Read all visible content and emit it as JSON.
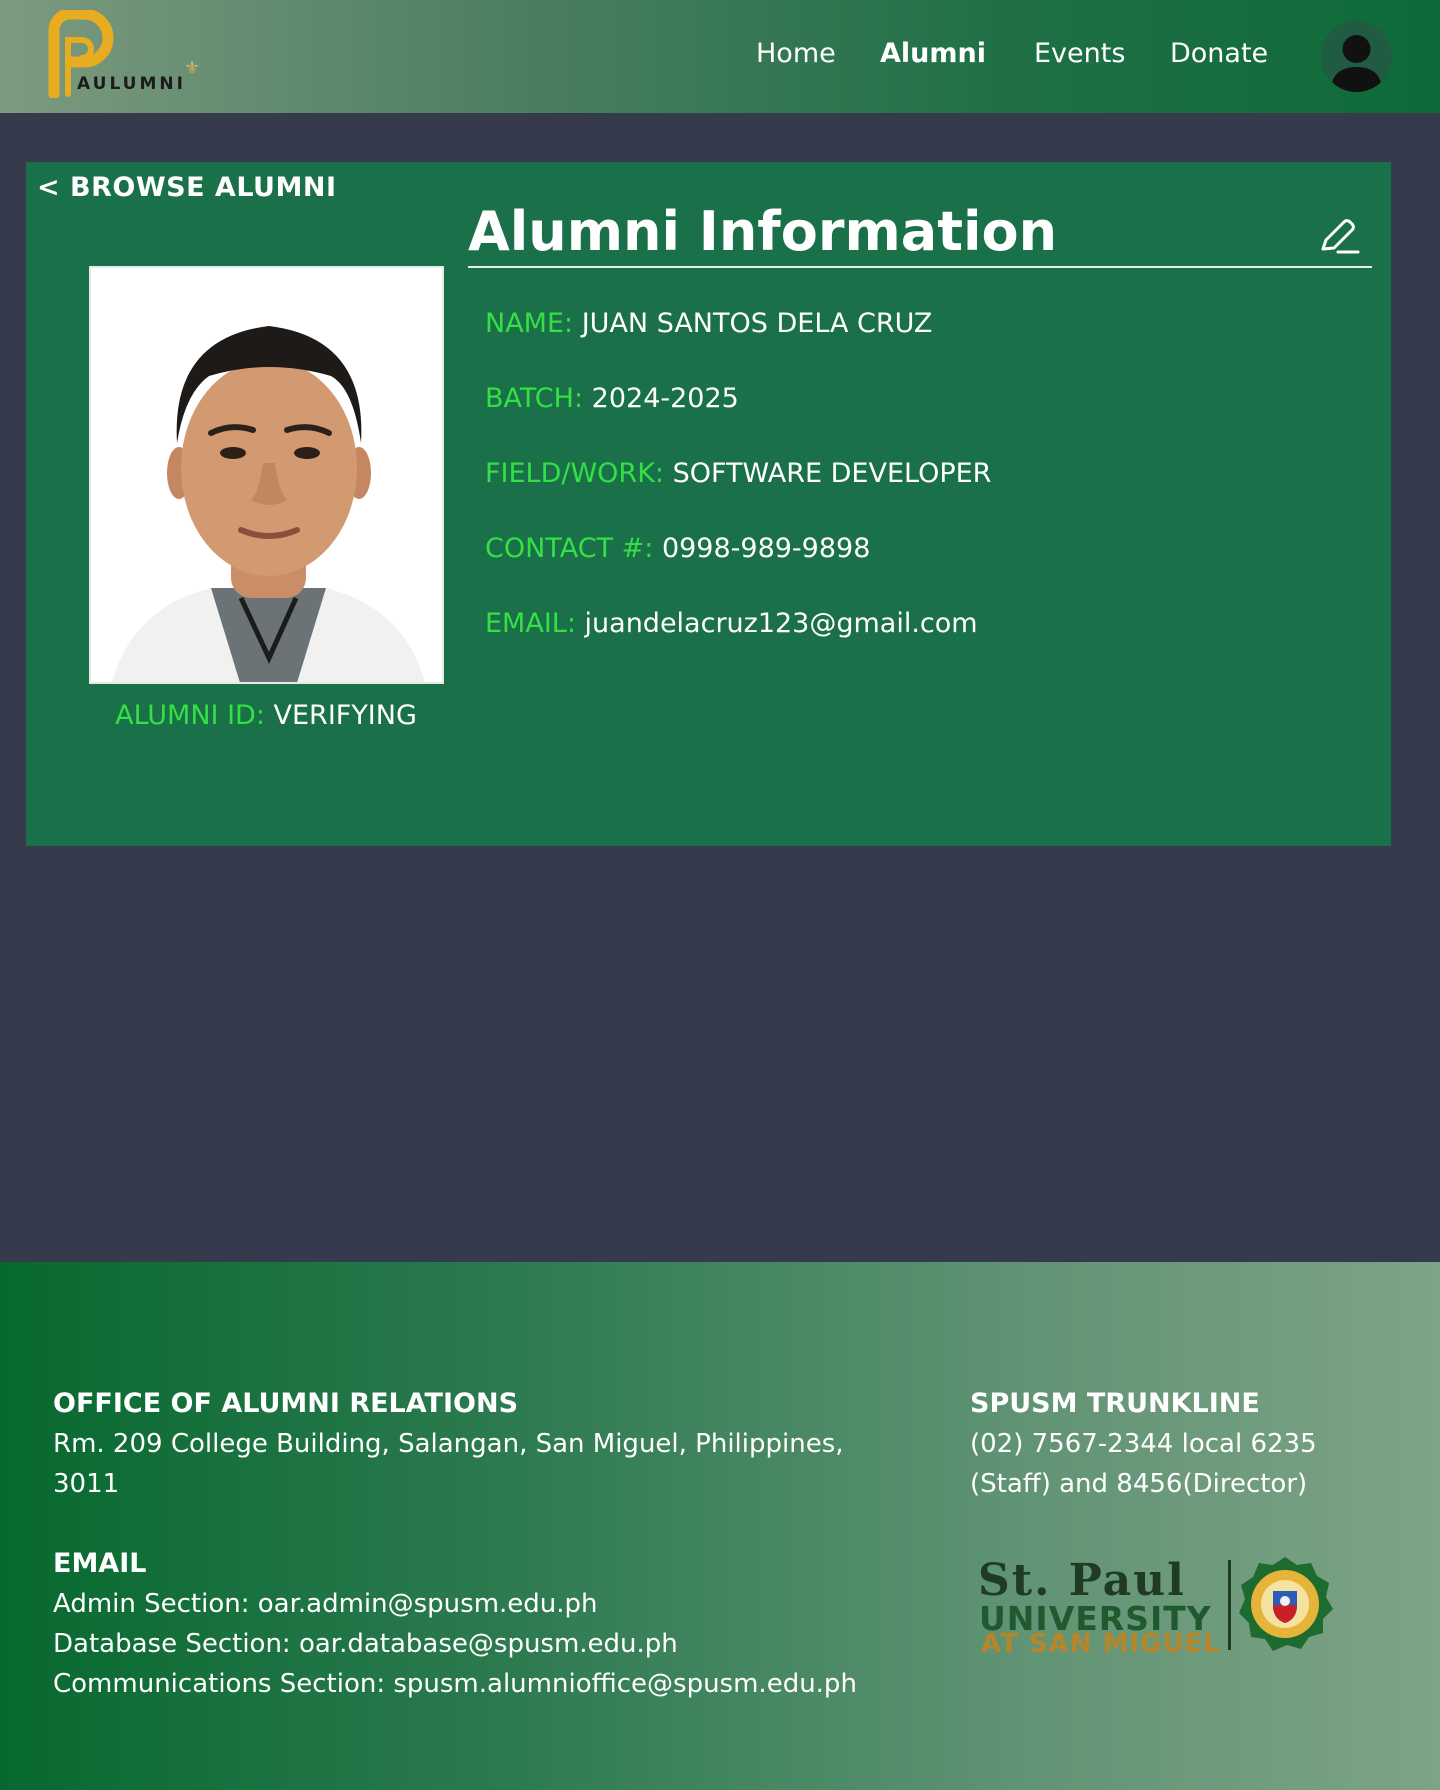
{
  "nav": {
    "logo_text": "AULUMNI",
    "links": [
      "Home",
      "Alumni",
      "Events",
      "Donate"
    ],
    "active": "Alumni"
  },
  "card": {
    "back_label": "< BROWSE ALUMNI",
    "title": "Alumni Information",
    "fields": [
      {
        "label": "NAME:",
        "value": "JUAN SANTOS DELA CRUZ"
      },
      {
        "label": "BATCH:",
        "value": "2024-2025"
      },
      {
        "label": "FIELD/WORK:",
        "value": "SOFTWARE DEVELOPER"
      },
      {
        "label": "CONTACT #:",
        "value": "0998-989-9898"
      },
      {
        "label": "EMAIL:",
        "value": "juandelacruz123@gmail.com"
      }
    ],
    "alumni_id_label": "ALUMNI ID:",
    "alumni_id_value": "VERIFYING"
  },
  "footer": {
    "office_heading": "OFFICE OF ALUMNI RELATIONS",
    "office_address_line1": "Rm. 209 College Building, Salangan, San Miguel, Philippines,",
    "office_address_line2": "3011",
    "email_heading": "EMAIL",
    "emails": [
      "Admin Section: oar.admin@spusm.edu.ph",
      "Database Section: oar.database@spusm.edu.ph",
      "Communications Section: spusm.alumnioffice@spusm.edu.ph"
    ],
    "trunkline_heading": "SPUSM TRUNKLINE",
    "trunkline_line1": "(02) 7567-2344 local 6235",
    "trunkline_line2": "(Staff) and 8456(Director)",
    "school_logo": {
      "line1": "St. Paul",
      "line2": "UNIVERSITY",
      "line3": "AT SAN MIGUEL"
    }
  },
  "colors": {
    "label_green": "#35e046",
    "card_green": "#1a7048",
    "page_bg": "#353a4d",
    "logo_gold": "#e8ac20"
  }
}
